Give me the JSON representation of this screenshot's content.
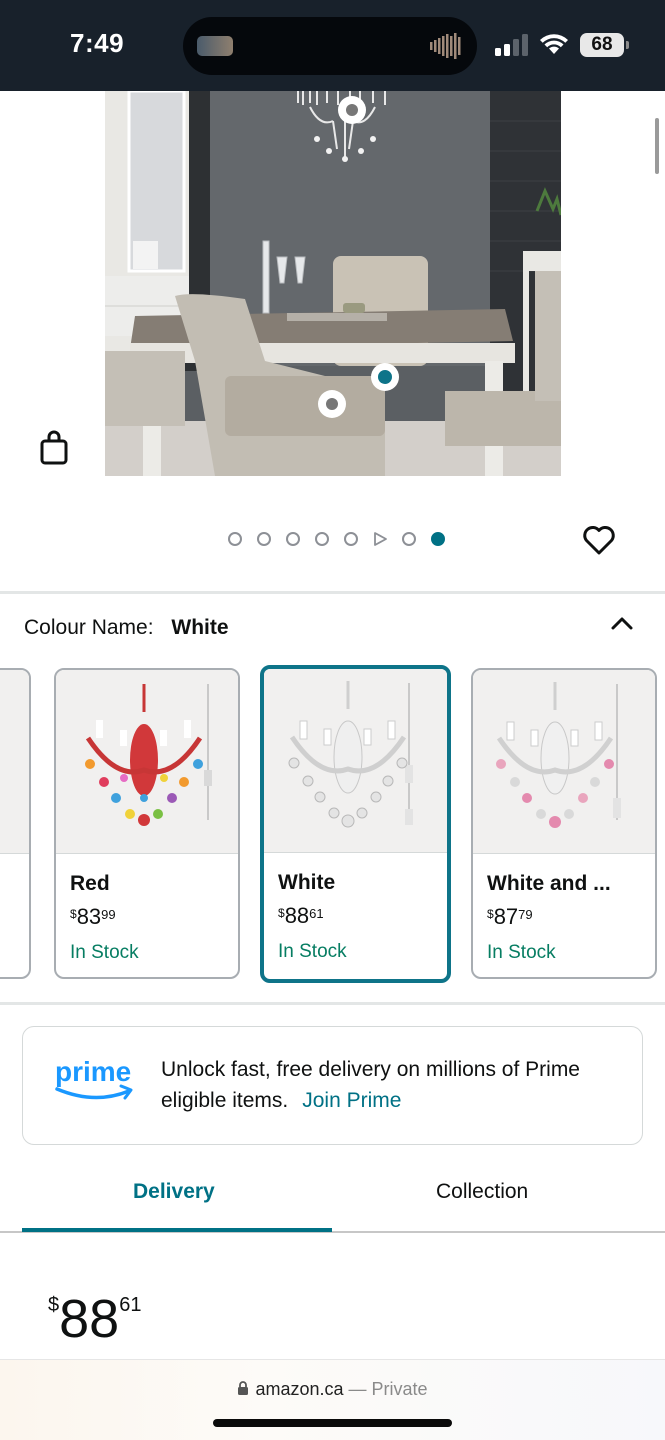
{
  "status_bar": {
    "time": "7:49",
    "battery": "68",
    "icons": [
      "signal-icon",
      "wifi-icon",
      "battery-icon"
    ]
  },
  "product": {
    "image_alt": "dining-room-with-chandelier",
    "carousel": {
      "count": 8,
      "active_index": 7,
      "video_index": 5
    }
  },
  "colour": {
    "label": "Colour Name:",
    "value": "White"
  },
  "swatches": [
    {
      "name": "Red",
      "currency": "$",
      "whole": "83",
      "fraction": "99",
      "stock": "In Stock",
      "selected": false
    },
    {
      "name": "White",
      "currency": "$",
      "whole": "88",
      "fraction": "61",
      "stock": "In Stock",
      "selected": true
    },
    {
      "name": "White and ...",
      "currency": "$",
      "whole": "87",
      "fraction": "79",
      "stock": "In Stock",
      "selected": false
    }
  ],
  "prime": {
    "logo_text": "prime",
    "message": "Unlock fast, free delivery on millions of Prime eligible items.",
    "link": "Join Prime"
  },
  "tabs": {
    "delivery": "Delivery",
    "collection": "Collection",
    "active": "Delivery"
  },
  "price": {
    "currency": "$",
    "whole": "88",
    "fraction": "61"
  },
  "browser": {
    "domain": "amazon.ca",
    "separator": "—",
    "mode": "Private"
  },
  "colors": {
    "accent": "#007185",
    "selected_border": "#0e7489",
    "in_stock": "#067d62",
    "status_bar": "#18212b"
  }
}
